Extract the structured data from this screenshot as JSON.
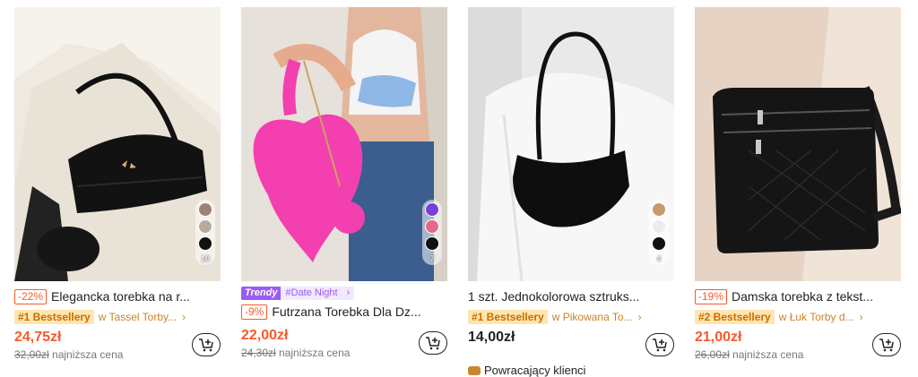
{
  "products": [
    {
      "discount": "-22%",
      "title": "Elegancka torebka na r...",
      "badge": "#1 Bestsellery",
      "category": "w Tassel Torby...",
      "price": "24,75zł",
      "old_price": "32,00zł",
      "lowest_label": "najniższa cena",
      "swatch_count": "10",
      "swatches": [
        "#9d8275",
        "#b7aba0",
        "#111111"
      ]
    },
    {
      "trendy_label": "Trendy",
      "trendy_tag": "#Date Night",
      "discount": "-9%",
      "title": "Futrzana Torebka Dla Dz...",
      "price": "22,00zł",
      "old_price": "24,30zł",
      "lowest_label": "najniższa cena",
      "swatch_count": "7",
      "swatches": [
        "#7a3fd9",
        "#e26a8a",
        "#111111"
      ]
    },
    {
      "title": "1 szt. Jednokolorowa sztruks...",
      "badge": "#1 Bestsellery",
      "category": "w Pikowana To...",
      "price": "14,00zł",
      "returning": "Powracający klienci",
      "swatch_count": "4",
      "swatches": [
        "#c99a6c",
        "#ececec",
        "#111111"
      ]
    },
    {
      "discount": "-19%",
      "title": "Damska torebka z tekst...",
      "badge": "#2 Bestsellery",
      "category": "w Łuk Torby d...",
      "price": "21,00zł",
      "old_price": "26,00zł",
      "lowest_label": "najniższa cena"
    }
  ],
  "colors": {
    "accent": "#f85a2c",
    "badge_bg": "#ffe6b0",
    "badge_text": "#c86e00",
    "trendy": "#9b5cf5"
  },
  "icons": {
    "cart": "cart-plus-icon",
    "chevron": "chevron-right-icon"
  }
}
